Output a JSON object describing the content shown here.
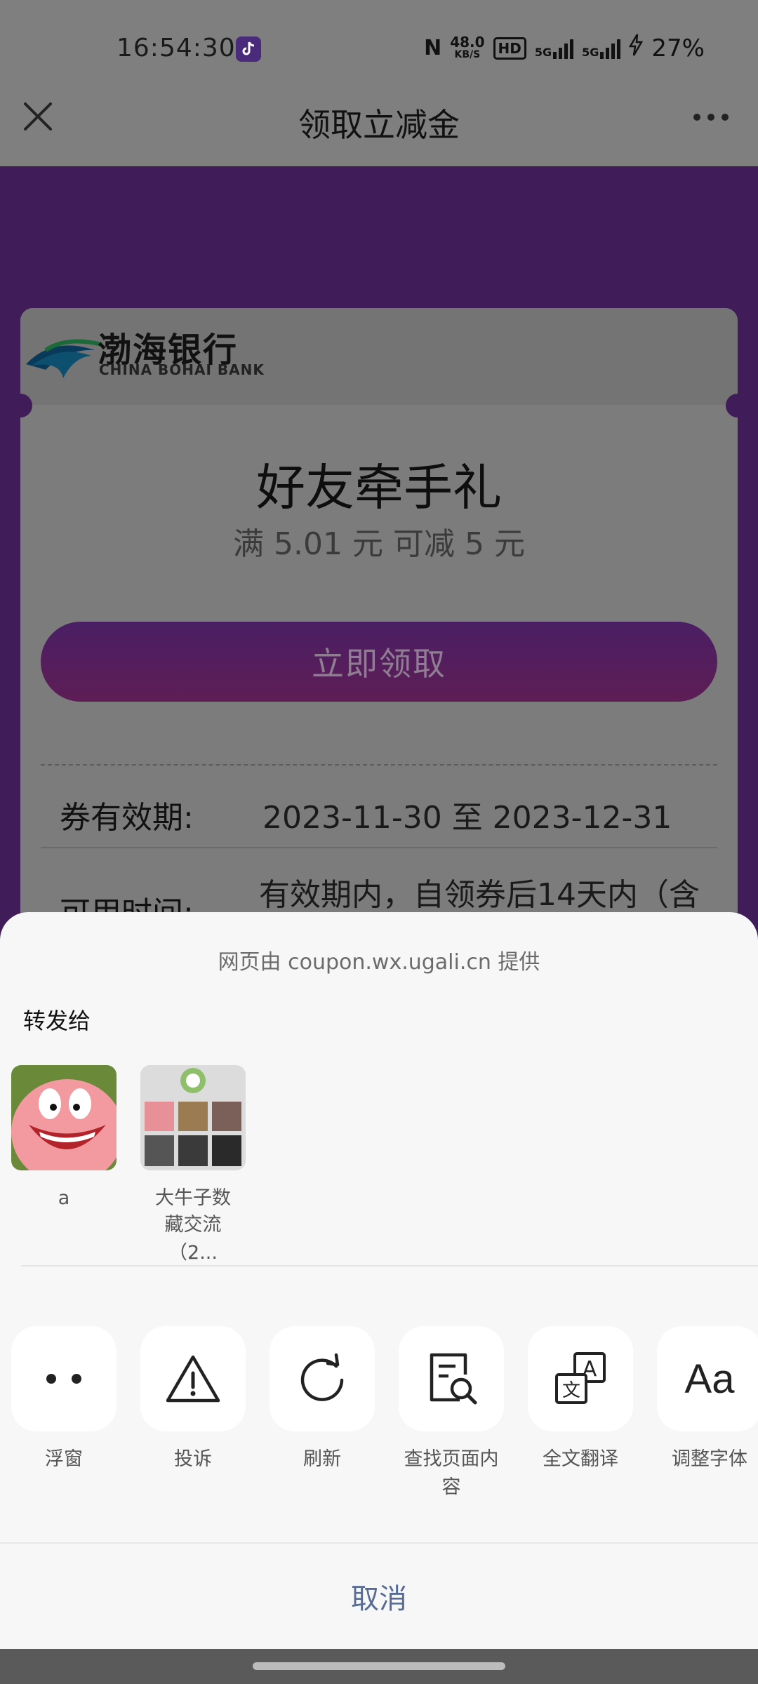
{
  "status_bar": {
    "time": "16:54:30",
    "network_speed_value": "48.0",
    "network_speed_unit": "KB/S",
    "hd_badge": "HD",
    "signal_1": "5G",
    "signal_2": "5G",
    "battery": "27%"
  },
  "navbar": {
    "title": "领取立减金"
  },
  "coupon": {
    "bank_name_cn": "渤海银行",
    "bank_name_en": "CHINA BOHAI BANK",
    "title": "好友牵手礼",
    "subtitle": "满 5.01 元 可减 5 元",
    "claim_button": "立即领取",
    "validity_label": "券有效期:",
    "validity_value": "2023-11-30 至 2023-12-31",
    "usage_label": "可用时间:",
    "usage_value": "有效期内，自领券后14天内（含"
  },
  "sheet": {
    "provider": "网页由 coupon.wx.ugali.cn 提供",
    "forward_label": "转发给",
    "contacts": [
      {
        "name": "a"
      },
      {
        "name_line1": "大牛子数",
        "name_line2": "藏交流（2..."
      }
    ],
    "actions": [
      {
        "label": "浮窗",
        "icon": "float-window-icon"
      },
      {
        "label": "投诉",
        "icon": "warning-icon"
      },
      {
        "label": "刷新",
        "icon": "refresh-icon"
      },
      {
        "label_line1": "查找页面内",
        "label_line2": "容",
        "icon": "find-in-page-icon"
      },
      {
        "label": "全文翻译",
        "icon": "translate-icon"
      },
      {
        "label": "调整字体",
        "icon": "font-size-icon",
        "glyph": "Aa"
      }
    ],
    "cancel": "取消"
  },
  "colors": {
    "purple_background": "#401c58",
    "cancel_link": "#576b95",
    "sheet_background": "#f7f7f7"
  }
}
